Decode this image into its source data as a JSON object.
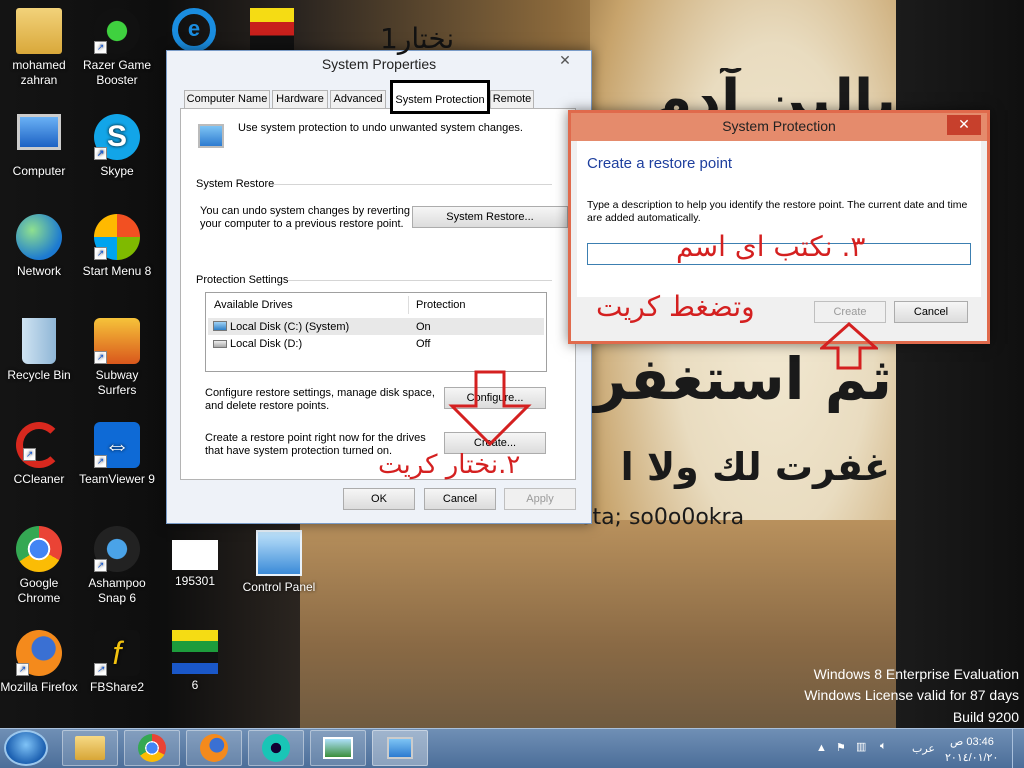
{
  "wallpaper": {
    "line1": "بالبن آدم",
    "line2": "ثم استغفر",
    "line3": "غفرت لك ولا ا",
    "credit": "...sta; so0o0okra"
  },
  "desktop_icons": [
    {
      "label": "mohamed zahran",
      "icon": "user-folder-icon"
    },
    {
      "label": "Razer Game Booster",
      "icon": "razer-icon"
    },
    {
      "label": "Computer",
      "icon": "computer-icon"
    },
    {
      "label": "Skype",
      "icon": "skype-icon"
    },
    {
      "label": "Network",
      "icon": "network-icon"
    },
    {
      "label": "Start Menu 8",
      "icon": "start-menu-icon"
    },
    {
      "label": "Recycle Bin",
      "icon": "recycle-bin-icon"
    },
    {
      "label": "Subway Surfers",
      "icon": "subway-surfers-icon"
    },
    {
      "label": "CCleaner",
      "icon": "ccleaner-icon"
    },
    {
      "label": "TeamViewer 9",
      "icon": "teamviewer-icon"
    },
    {
      "label": "Google Chrome",
      "icon": "chrome-icon"
    },
    {
      "label": "Ashampoo Snap 6",
      "icon": "ashampoo-icon"
    },
    {
      "label": "195301",
      "icon": "image-file-icon"
    },
    {
      "label": "Control Panel",
      "icon": "control-panel-icon"
    },
    {
      "label": "Mozilla Firefox",
      "icon": "firefox-icon"
    },
    {
      "label": "FBShare2",
      "icon": "fbshare-icon"
    },
    {
      "label": "6",
      "icon": "flag-image-icon"
    }
  ],
  "watermark": {
    "line1": "Windows 8 Enterprise Evaluation",
    "line2": "Windows License valid for 87 days",
    "line3": "Build 9200"
  },
  "annotations": {
    "step1": "نختار1",
    "step2": "٢.نختار كريت",
    "step3a": "٣. نكتب اى اسم",
    "step3b": "وتضغط كريت"
  },
  "system_properties": {
    "title": "System Properties",
    "tabs": [
      "Computer Name",
      "Hardware",
      "Advanced",
      "System Protection",
      "Remote"
    ],
    "active_tab": "System Protection",
    "intro": "Use system protection to undo unwanted system changes.",
    "restore_section": "System Restore",
    "restore_text": "You can undo system changes by reverting your computer to a previous restore point.",
    "restore_button": "System Restore...",
    "protection_section": "Protection Settings",
    "drives_columns": [
      "Available Drives",
      "Protection"
    ],
    "drives": [
      {
        "name": "Local Disk (C:) (System)",
        "protection": "On"
      },
      {
        "name": "Local Disk (D:)",
        "protection": "Off"
      }
    ],
    "configure_text": "Configure restore settings, manage disk space, and delete restore points.",
    "configure_button": "Configure...",
    "create_text": "Create a restore point right now for the drives that have system protection turned on.",
    "create_button": "Create...",
    "ok": "OK",
    "cancel": "Cancel",
    "apply": "Apply"
  },
  "restore_dialog": {
    "title": "System Protection",
    "heading": "Create a restore point",
    "description": "Type a description to help you identify the restore point. The current date and time are added automatically.",
    "input_value": "",
    "create": "Create",
    "cancel": "Cancel"
  },
  "taskbar": {
    "apps": [
      "explorer-icon",
      "chrome-icon",
      "firefox-icon",
      "media-player-icon",
      "photo-viewer-icon",
      "system-properties-icon"
    ],
    "language": "عرب",
    "time": "03:46 ص",
    "date": "٢٠١٤/٠١/٢٠"
  }
}
